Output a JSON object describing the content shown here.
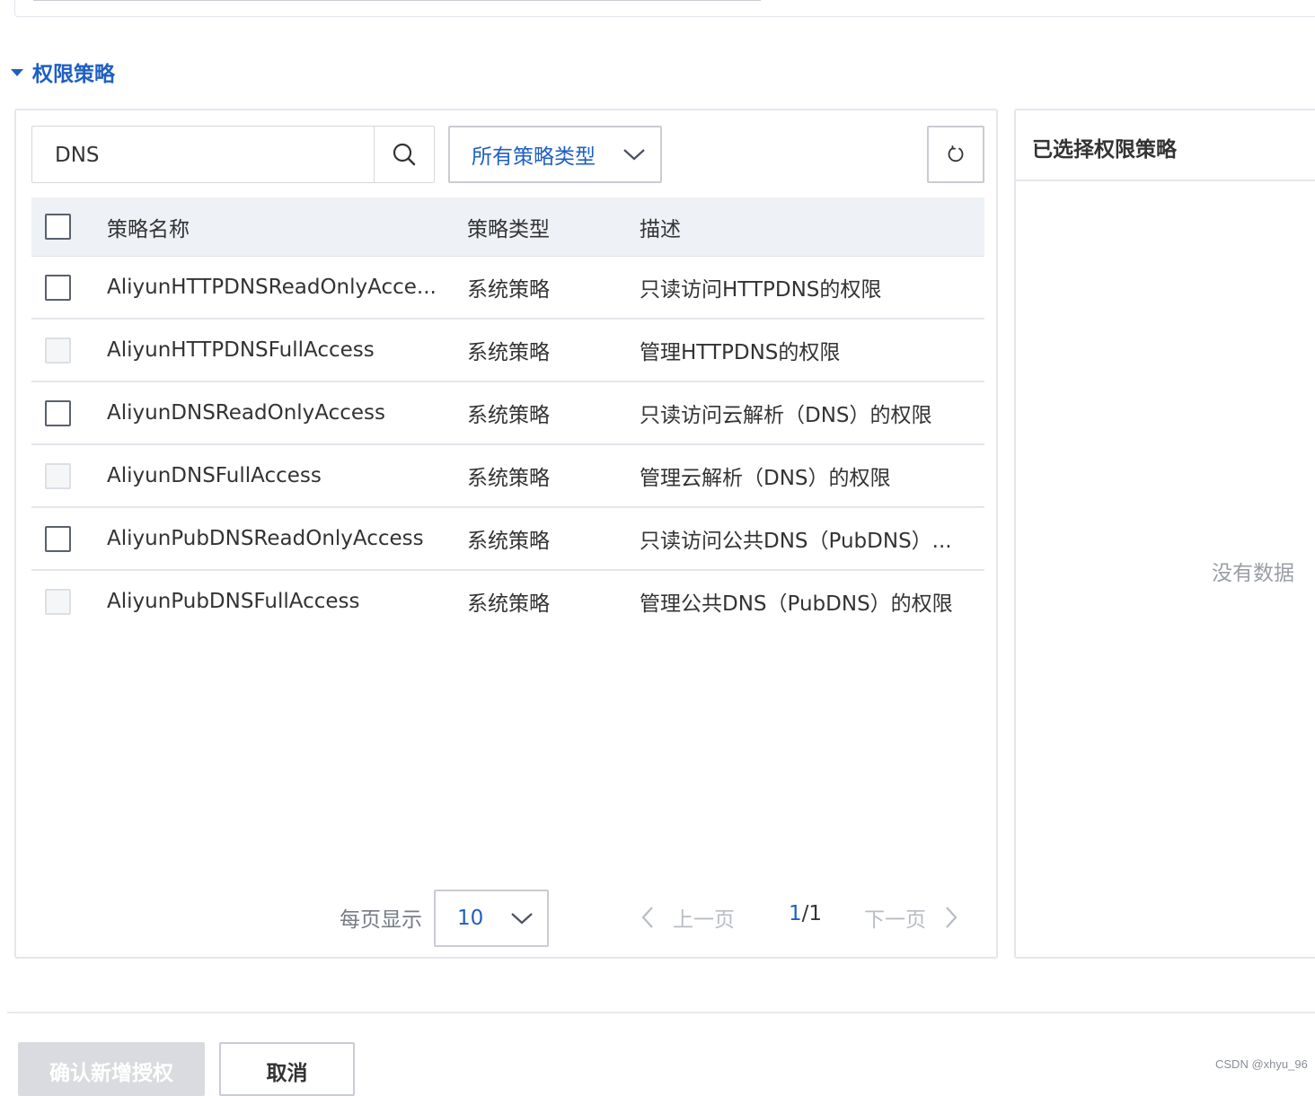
{
  "section": {
    "title": "权限策略"
  },
  "search": {
    "value": "DNS"
  },
  "type_filter": {
    "selected": "所有策略类型"
  },
  "table": {
    "headers": {
      "name": "策略名称",
      "type": "策略类型",
      "desc": "描述"
    },
    "rows": [
      {
        "name": "AliyunHTTPDNSReadOnlyAcce...",
        "type": "系统策略",
        "desc": "只读访问HTTPDNS的权限",
        "checkbox_disabled": false
      },
      {
        "name": "AliyunHTTPDNSFullAccess",
        "type": "系统策略",
        "desc": "管理HTTPDNS的权限",
        "checkbox_disabled": true
      },
      {
        "name": "AliyunDNSReadOnlyAccess",
        "type": "系统策略",
        "desc": "只读访问云解析（DNS）的权限",
        "checkbox_disabled": false
      },
      {
        "name": "AliyunDNSFullAccess",
        "type": "系统策略",
        "desc": "管理云解析（DNS）的权限",
        "checkbox_disabled": true
      },
      {
        "name": "AliyunPubDNSReadOnlyAccess",
        "type": "系统策略",
        "desc": "只读访问公共DNS（PubDNS）...",
        "checkbox_disabled": false
      },
      {
        "name": "AliyunPubDNSFullAccess",
        "type": "系统策略",
        "desc": "管理公共DNS（PubDNS）的权限",
        "checkbox_disabled": true
      }
    ]
  },
  "pagination": {
    "per_page_label": "每页显示",
    "per_page_value": "10",
    "prev_label": "上一页",
    "current_page": "1",
    "page_separator": "/",
    "total_pages": "1",
    "next_label": "下一页"
  },
  "selected_panel": {
    "title": "已选择权限策略",
    "empty_text": "没有数据"
  },
  "footer": {
    "confirm_label": "确认新增授权",
    "cancel_label": "取消",
    "watermark": "CSDN @xhyu_96"
  },
  "colors": {
    "accent": "#1f5fc2",
    "header_bg": "#eef1f6",
    "border": "#e3e6ec",
    "disabled_btn": "#d9dbe0"
  },
  "icons": {
    "section": "caret-down-icon",
    "search": "search-icon",
    "dropdown": "chevron-down-icon",
    "refresh": "refresh-icon",
    "prev": "chevron-left-icon",
    "next": "chevron-right-icon"
  }
}
